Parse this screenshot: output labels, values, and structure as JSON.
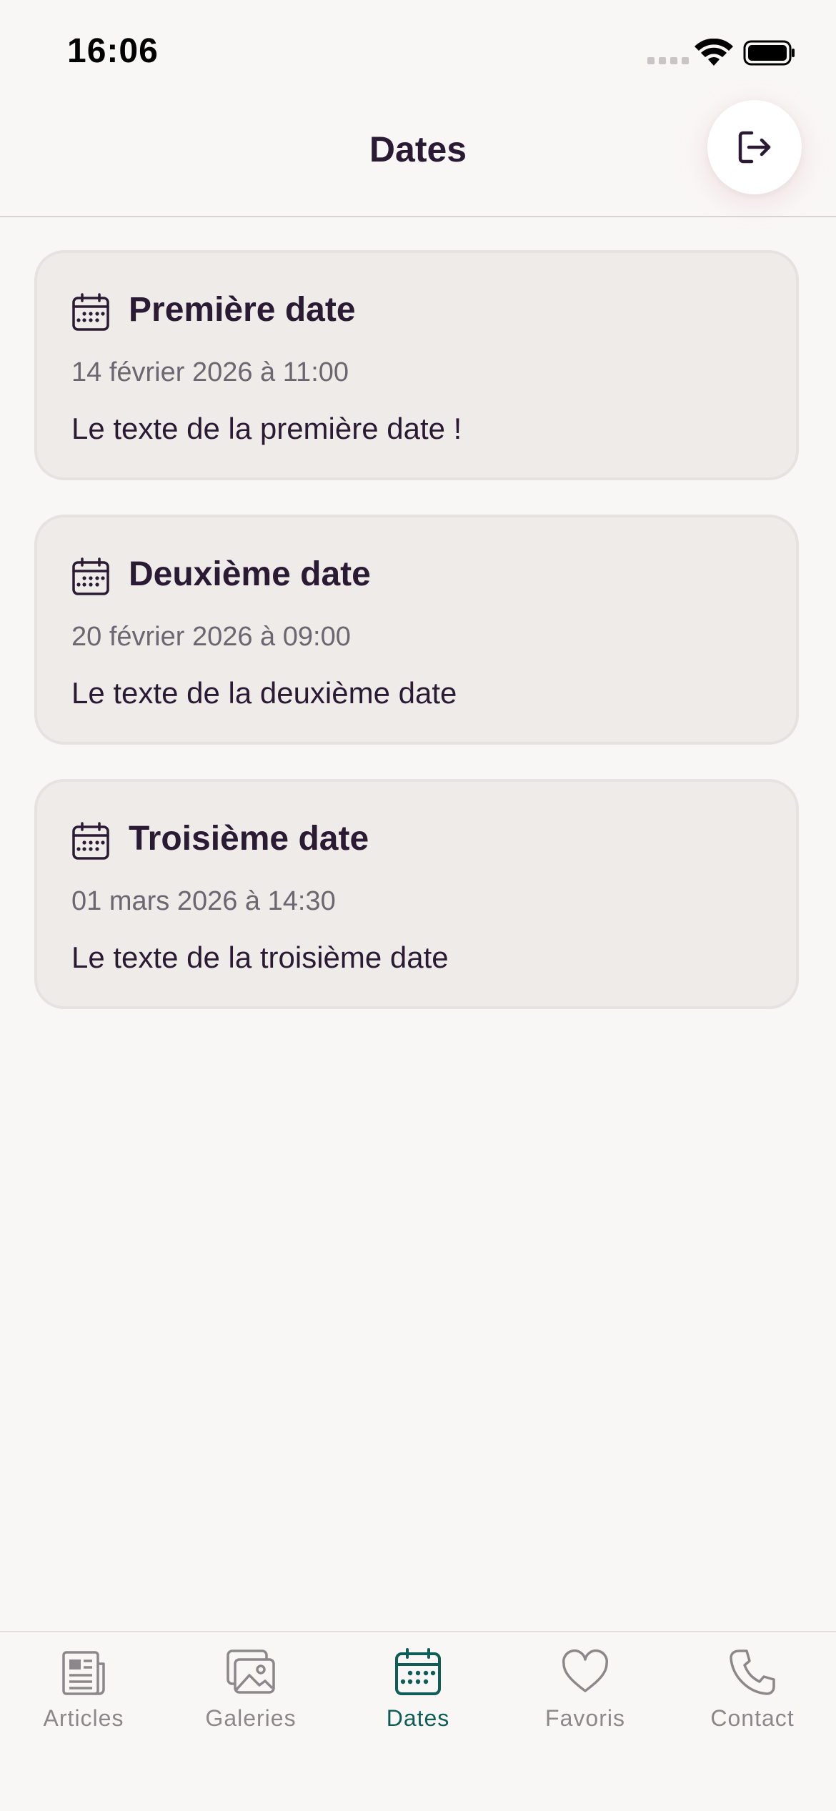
{
  "status_bar": {
    "time": "16:06"
  },
  "header": {
    "title": "Dates"
  },
  "dates": [
    {
      "title": "Première date",
      "date": "14 février 2026 à 11:00",
      "text": "Le texte de la première date !"
    },
    {
      "title": "Deuxième date",
      "date": "20 février 2026 à 09:00",
      "text": "Le texte de la deuxième date"
    },
    {
      "title": "Troisième date",
      "date": "01 mars 2026 à 14:30",
      "text": "Le texte de la troisième date"
    }
  ],
  "tabbar": {
    "tabs": [
      {
        "label": "Articles",
        "icon": "newspaper-icon",
        "active": false
      },
      {
        "label": "Galeries",
        "icon": "images-icon",
        "active": false
      },
      {
        "label": "Dates",
        "icon": "calendar-icon",
        "active": true
      },
      {
        "label": "Favoris",
        "icon": "heart-icon",
        "active": false
      },
      {
        "label": "Contact",
        "icon": "phone-icon",
        "active": false
      }
    ]
  },
  "colors": {
    "accent": "#0e5d57",
    "text": "#2a1a33",
    "card_bg": "#efebe9",
    "inactive": "#8c878a"
  }
}
